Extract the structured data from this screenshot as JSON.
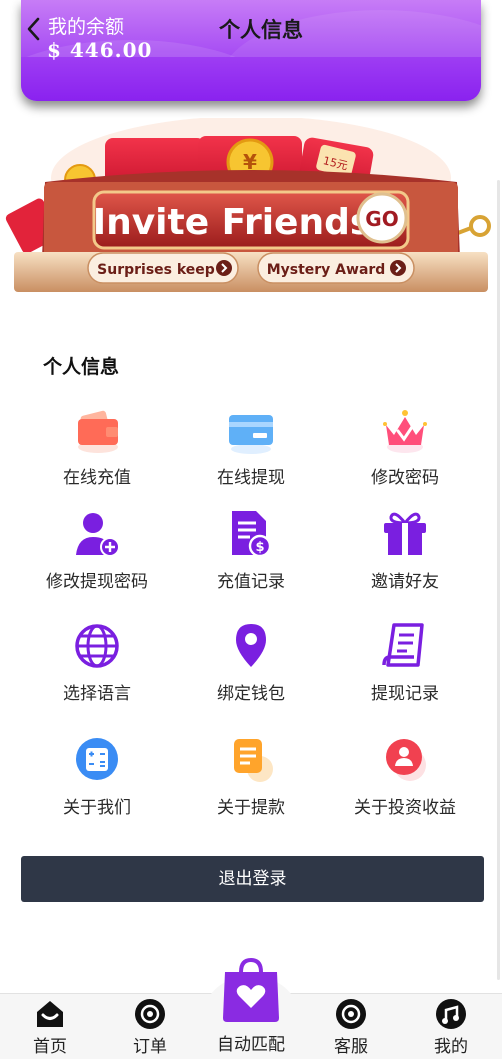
{
  "header": {
    "title": "个人信息",
    "balance_label": "我的余额",
    "balance_value": "$ 446.00"
  },
  "banner": {
    "headline": "Invite Friends",
    "go": "GO",
    "pill_left": "Surprises keep",
    "pill_right": "Mystery Award",
    "yen": "¥",
    "coupon": "15元"
  },
  "section": {
    "title": "个人信息"
  },
  "menu": [
    {
      "label": "在线充值",
      "icon": "wallet-icon"
    },
    {
      "label": "在线提现",
      "icon": "card-icon"
    },
    {
      "label": "修改密码",
      "icon": "crown-icon"
    },
    {
      "label": "修改提现密码",
      "icon": "user-add-icon"
    },
    {
      "label": "充值记录",
      "icon": "document-dollar-icon"
    },
    {
      "label": "邀请好友",
      "icon": "gift-icon"
    },
    {
      "label": "选择语言",
      "icon": "globe-icon"
    },
    {
      "label": "绑定钱包",
      "icon": "location-pin-icon"
    },
    {
      "label": "提现记录",
      "icon": "scroll-icon"
    },
    {
      "label": "关于我们",
      "icon": "calculator-icon"
    },
    {
      "label": "关于提款",
      "icon": "notes-icon"
    },
    {
      "label": "关于投资收益",
      "icon": "person-badge-icon"
    }
  ],
  "logout_label": "退出登录",
  "tabbar": {
    "home": "首页",
    "orders": "订单",
    "auto_match": "自动匹配",
    "service": "客服",
    "mine": "我的"
  },
  "colors": {
    "header_top": "#c77cf6",
    "header_bottom": "#8f2cf0",
    "icon_purple": "#7a1fe0",
    "logout_bg": "#2f3747"
  }
}
